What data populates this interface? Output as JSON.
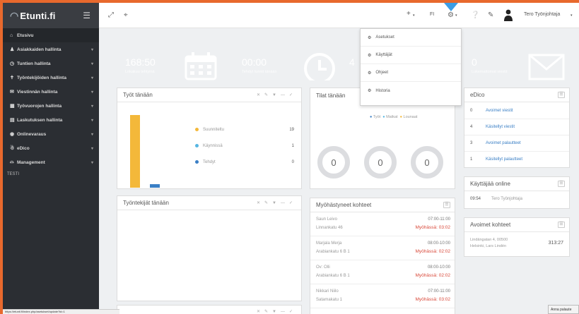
{
  "brand": {
    "logo": "Etunti.fi"
  },
  "topbar": {
    "plus": "+",
    "language": "FI",
    "user_name": "Tero Työnjohtaja"
  },
  "sidebar": {
    "items": [
      {
        "label": "Etusivu",
        "icon": "home-icon"
      },
      {
        "label": "Asiakkaiden hallinta",
        "icon": "user-icon"
      },
      {
        "label": "Tuntien hallinta",
        "icon": "clock-icon"
      },
      {
        "label": "Työntekijöiden hallinta",
        "icon": "person-icon"
      },
      {
        "label": "Viestinnän hallinta",
        "icon": "envelope-icon"
      },
      {
        "label": "Työvuorojen hallinta",
        "icon": "calendar-icon"
      },
      {
        "label": "Laskutuksen hallinta",
        "icon": "invoice-icon"
      },
      {
        "label": "Onlinevaraus",
        "icon": "globe-icon"
      },
      {
        "label": "eDico",
        "icon": "group-icon"
      },
      {
        "label": "Management",
        "icon": "chart-icon"
      }
    ],
    "footer": "TESTI"
  },
  "tiles": [
    {
      "value": "168:50",
      "label": "Lokakuu tehtyinä",
      "color": "#9b7bd8"
    },
    {
      "value": "00:00",
      "label": "Tehdyt tunnit tänään",
      "color": "#56b6e2"
    },
    {
      "value": "4",
      "label": "",
      "color": "#f3b83a"
    },
    {
      "value": "0",
      "label": "Lukemattomat viestit",
      "color": "#ec6a58"
    }
  ],
  "tyot": {
    "title": "Työt tänään",
    "legend": [
      {
        "label": "Suunniteltu",
        "count": "19",
        "color": "#f3b83a"
      },
      {
        "label": "Käynnissä",
        "count": "1",
        "color": "#56b6e2"
      },
      {
        "label": "Tehdyt",
        "count": "0",
        "color": "#3a7fc5"
      }
    ]
  },
  "tilat": {
    "title": "Tilat tänään",
    "legend": [
      "Työt",
      "Matkat",
      "Lounaat"
    ],
    "rings": [
      "0",
      "0",
      "0"
    ]
  },
  "edico": {
    "title": "eDico",
    "rows": [
      {
        "n": "0",
        "label": "Avoimet viestit"
      },
      {
        "n": "4",
        "label": "Käsitellyt viestit"
      },
      {
        "n": "3",
        "label": "Avoimet palautteet"
      },
      {
        "n": "1",
        "label": "Käsitellyt palautteet"
      }
    ]
  },
  "online": {
    "title": "Käyttäjää online",
    "time": "09:54",
    "user": "Tero Työnjohtaja"
  },
  "avoimet": {
    "title": "Avoimet kohteet",
    "line1": "Lindängatan 4, 00500",
    "line2": "Helsinki, Lars Lindén",
    "value": "313:27"
  },
  "tyontekijat": {
    "title": "Työntekijät tänään"
  },
  "myohassa": {
    "title": "Myöhästyneet kohteet",
    "rows": [
      {
        "name": "Saun Leivo",
        "address": "Linnankatu 46",
        "time": "07:00-11:00",
        "status": "Myöhässä: 03:02"
      },
      {
        "name": "Marjala Merja",
        "address": "Arabiankatu 6 B 1",
        "time": "08:00-10:00",
        "status": "Myöhässä: 02:02"
      },
      {
        "name": "Ov: Olli",
        "address": "Arabiankatu 6 B 1",
        "time": "08:00-10:00",
        "status": "Myöhässä: 02:02"
      },
      {
        "name": "Nikkari Niilo",
        "address": "Satamakatu 1",
        "time": "07:00-11:00",
        "status": "Myöhässä: 03:02"
      }
    ]
  },
  "dropdown": {
    "items": [
      "Asetukset",
      "Käyttäjät",
      "Ohjeet",
      "Historia"
    ]
  },
  "status_url": "https://etunti.fi/index.php/asetukset/update?id=1",
  "tooltip": "Anna palaute"
}
